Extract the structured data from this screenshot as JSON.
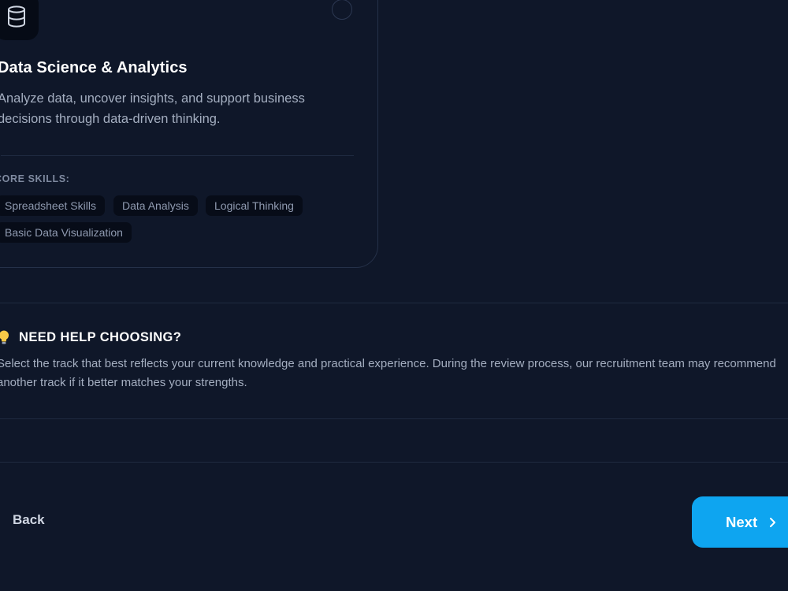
{
  "track_card": {
    "icon": "database-icon",
    "title": "Data Science & Analytics",
    "description": "Analyze data, uncover insights, and support business decisions through data-driven thinking.",
    "skills_label": "CORE SKILLS:",
    "skills": [
      "Spreadsheet Skills",
      "Data Analysis",
      "Logical Thinking",
      "Basic Data Visualization"
    ]
  },
  "help": {
    "icon": "lightbulb-icon",
    "title": "NEED HELP CHOOSING?",
    "text": "Select the track that best reflects your current knowledge and practical experience. During the review process, our recruitment team may recommend another track if it better matches your strengths."
  },
  "footer": {
    "back_label": "Back",
    "next_label": "Next",
    "next_icon": "chevron-right-icon"
  },
  "colors": {
    "background": "#0f1729",
    "accent": "#0ea5f0",
    "chip_background": "#070c18"
  }
}
